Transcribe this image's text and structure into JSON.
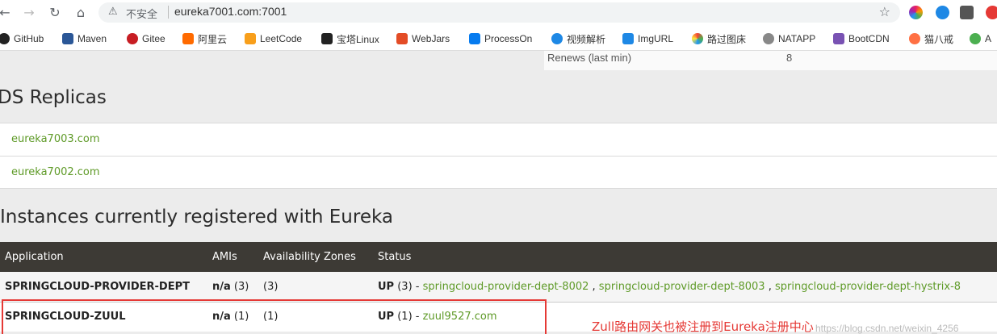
{
  "browser": {
    "security_label": "不安全",
    "url": "eureka7001.com:7001"
  },
  "bookmarks": [
    {
      "label": "GitHub",
      "icon": "github-icon",
      "color": "#222222"
    },
    {
      "label": "Maven",
      "icon": "maven-icon",
      "color": "#2b5797"
    },
    {
      "label": "Gitee",
      "icon": "gitee-icon",
      "color": "#c71d23"
    },
    {
      "label": "阿里云",
      "icon": "aliyun-icon",
      "color": "#ff6a00"
    },
    {
      "label": "LeetCode",
      "icon": "leetcode-icon",
      "color": "#f89f1b"
    },
    {
      "label": "宝塔Linux",
      "icon": "bt-icon",
      "color": "#20a53a"
    },
    {
      "label": "WebJars",
      "icon": "webjars-icon",
      "color": "#e34c26"
    },
    {
      "label": "ProcessOn",
      "icon": "processon-icon",
      "color": "#067bef"
    },
    {
      "label": "视频解析",
      "icon": "video-icon",
      "color": "#1e88e5"
    },
    {
      "label": "ImgURL",
      "icon": "imgurl-icon",
      "color": "#1e88e5"
    },
    {
      "label": "路过图床",
      "icon": "luguo-icon",
      "color": "#4caf50"
    },
    {
      "label": "NATAPP",
      "icon": "natapp-icon",
      "color": "#666666"
    },
    {
      "label": "BootCDN",
      "icon": "bootcdn-icon",
      "color": "#7952b3"
    },
    {
      "label": "猫八戒",
      "icon": "mao-icon",
      "color": "#ff7043"
    },
    {
      "label": "A",
      "icon": "a-icon",
      "color": "#4caf50"
    }
  ],
  "general": {
    "renews_label": "Renews (last min)",
    "renews_value": "8"
  },
  "replicas": {
    "title": "DS Replicas",
    "items": [
      "eureka7003.com",
      "eureka7002.com"
    ]
  },
  "instances": {
    "title": "Instances currently registered with Eureka",
    "headers": [
      "Application",
      "AMIs",
      "Availability Zones",
      "Status"
    ],
    "rows": [
      {
        "application": "SPRINGCLOUD-PROVIDER-DEPT",
        "amis_value": "n/a",
        "amis_count": "(3)",
        "zones": "(3)",
        "status_prefix": "UP",
        "status_count": "(3) -",
        "links": [
          "springcloud-provider-dept-8002",
          "springcloud-provider-dept-8003",
          "springcloud-provider-dept-hystrix-8"
        ]
      },
      {
        "application": "SPRINGCLOUD-ZUUL",
        "amis_value": "n/a",
        "amis_count": "(1)",
        "zones": "(1)",
        "status_prefix": "UP",
        "status_count": "(1) -",
        "links": [
          "zuul9527.com"
        ]
      }
    ]
  },
  "annotation": "Zull路由网关也被注册到Eureka注册中心",
  "watermark": "https://blog.csdn.net/weixin_4256",
  "colors": {
    "link_green": "#5e9a27",
    "table_header": "#3d3a35",
    "annotation_red": "#e53935"
  }
}
